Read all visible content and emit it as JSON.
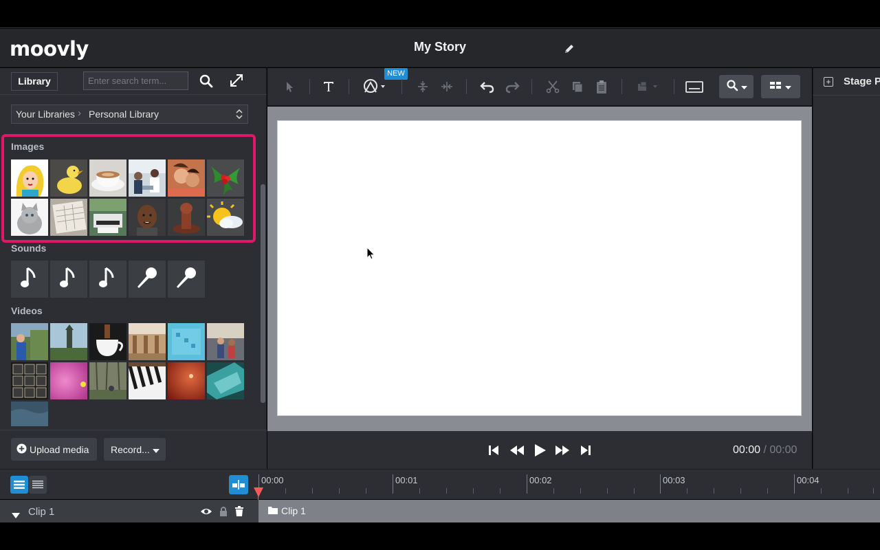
{
  "app": {
    "logo_text": "moovly",
    "story_title": "My Story"
  },
  "library": {
    "tab_label": "Library",
    "search_placeholder": "Enter search term...",
    "breadcrumb": [
      "Your Libraries",
      "Personal Library"
    ],
    "sections": {
      "images": "Images",
      "sounds": "Sounds",
      "videos": "Videos"
    },
    "images": [
      "pop-art-woman",
      "duckling",
      "coffee-cup",
      "office-people",
      "laughing-people",
      "holly",
      "kitten",
      "calendar",
      "printer",
      "man-portrait",
      "stamp",
      "sun-cloud"
    ],
    "sounds": [
      "music-note-icon",
      "music-note-icon",
      "music-note-icon",
      "microphone-icon",
      "microphone-icon"
    ],
    "videos": [
      "woman-park",
      "tower",
      "coffee-pour",
      "office-hall",
      "blue-screen",
      "meeting",
      "keyboard",
      "pink-texture",
      "forest",
      "piano",
      "red-glow",
      "teal-abstract",
      "blue-ocean"
    ],
    "upload_label": "Upload media",
    "record_label": "Record..."
  },
  "toolbar": {
    "new_badge": "NEW"
  },
  "right_panel": {
    "title": "Stage Properties"
  },
  "playback": {
    "current_time": "00:00",
    "separator": "/",
    "duration": "00:00"
  },
  "timeline": {
    "ticks": [
      "00:00",
      "00:01",
      "00:02",
      "00:03",
      "00:04"
    ],
    "track_name": "Clip 1",
    "clip_label": "Clip 1"
  },
  "colors": {
    "accent_blue": "#1e8fd6",
    "highlight_pink": "#e3176a",
    "playhead_red": "#ff5a5a"
  }
}
